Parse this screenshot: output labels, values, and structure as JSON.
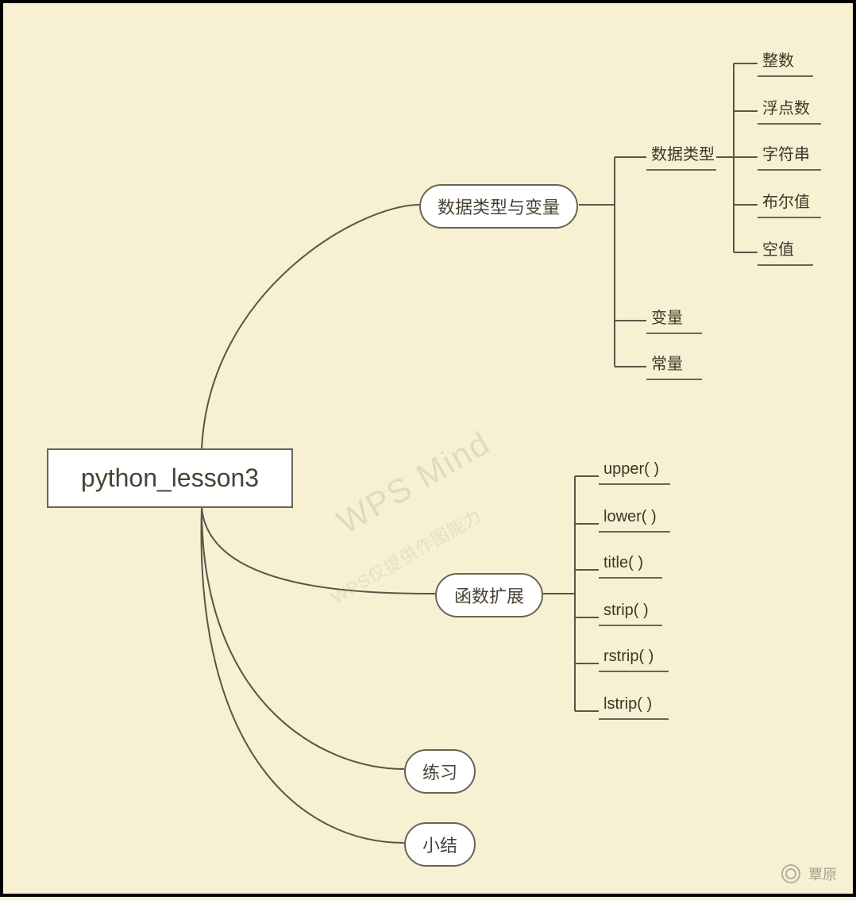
{
  "root": {
    "label": "python_lesson3"
  },
  "branches": [
    {
      "label": "数据类型与变量",
      "children": [
        {
          "label": "数据类型",
          "children": [
            {
              "label": "整数"
            },
            {
              "label": "浮点数"
            },
            {
              "label": "字符串"
            },
            {
              "label": "布尔值"
            },
            {
              "label": "空值"
            }
          ]
        },
        {
          "label": "变量"
        },
        {
          "label": "常量"
        }
      ]
    },
    {
      "label": "函数扩展",
      "children": [
        {
          "label": "upper( )"
        },
        {
          "label": "lower( )"
        },
        {
          "label": "title( )"
        },
        {
          "label": "strip( )"
        },
        {
          "label": "rstrip( )"
        },
        {
          "label": "lstrip( )"
        }
      ]
    },
    {
      "label": "练习"
    },
    {
      "label": "小结"
    }
  ],
  "watermark": {
    "main": "WPS Mind",
    "sub": "WPS仅提供作图能力"
  },
  "footer": {
    "label": "覃原"
  }
}
